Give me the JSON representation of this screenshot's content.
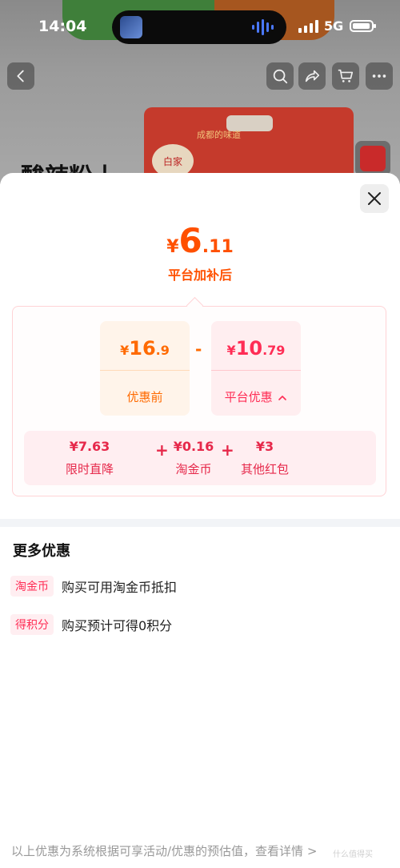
{
  "status_bar": {
    "time": "14:04",
    "network": "5G"
  },
  "background": {
    "product_label": "白家",
    "product_text": "成都的味道",
    "title": "酸辣粉丨"
  },
  "top_bar": {
    "icons": [
      "back-icon",
      "search-icon",
      "share-icon",
      "cart-icon",
      "more-icon"
    ]
  },
  "sheet": {
    "price": {
      "currency": "¥",
      "integer": "6",
      "decimal": ".11",
      "caption": "平台加补后"
    },
    "breakdown": {
      "before": {
        "currency": "¥",
        "integer": "16",
        "decimal": ".9",
        "label": "优惠前"
      },
      "operator": "-",
      "discount": {
        "currency": "¥",
        "integer": "10",
        "decimal": ".79",
        "label": "平台优惠"
      },
      "items": [
        {
          "value": "¥7.63",
          "label": "限时直降"
        },
        {
          "value": "¥0.16",
          "label": "淘金币"
        },
        {
          "value": "¥3",
          "label": "其他红包"
        }
      ],
      "plus": "+"
    },
    "more": {
      "title": "更多优惠",
      "rows": [
        {
          "tag": "淘金币",
          "text": "购买可用淘金币抵扣"
        },
        {
          "tag": "得积分",
          "text": "购买预计可得0积分"
        }
      ]
    },
    "footer": "以上优惠为系统根据可享活动/优惠的预估值，查看详情 >",
    "watermark": "什么值得买"
  },
  "colors": {
    "accent_orange": "#ff5000",
    "accent_red": "#ff2d55",
    "footer_gray": "#999999"
  }
}
